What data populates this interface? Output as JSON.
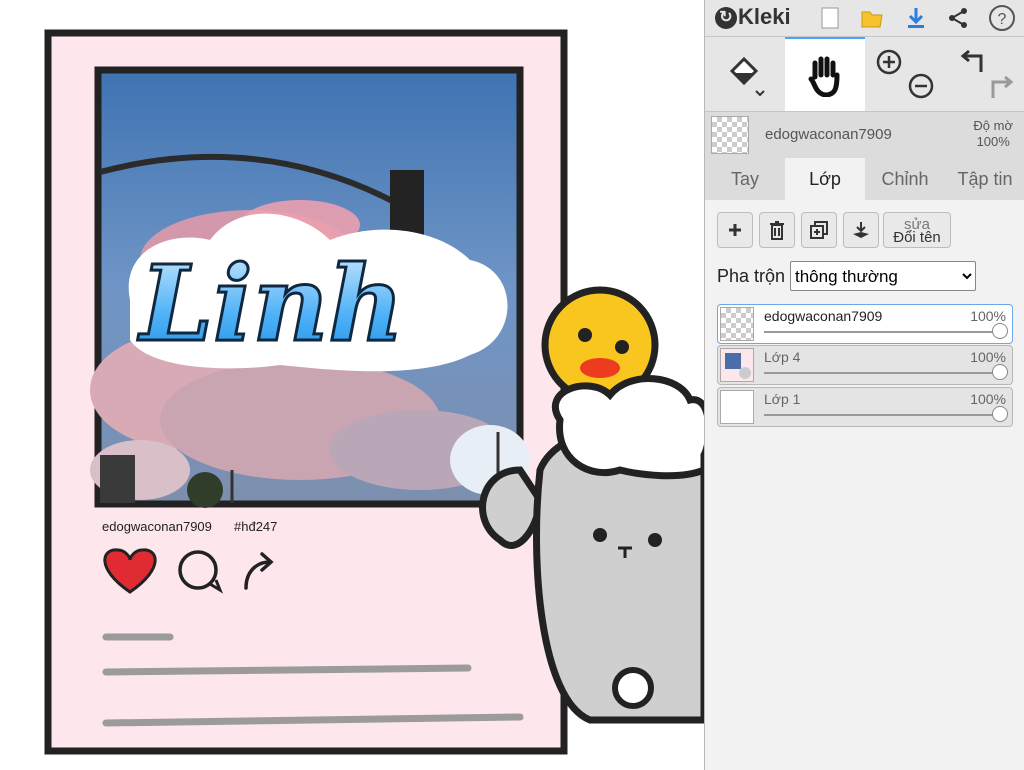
{
  "app": {
    "name": "Kleki"
  },
  "canvas": {
    "artwork_title": "Linh",
    "caption_user": "edogwaconan7909",
    "caption_tag": "#hđ247"
  },
  "toolbar": {
    "icons": [
      "new-file-icon",
      "open-folder-icon",
      "download-icon",
      "share-icon",
      "help-icon"
    ]
  },
  "tools": {
    "icons": [
      "paint-bucket-icon",
      "hand-icon",
      "zoom-in-icon",
      "zoom-out-icon",
      "undo-icon",
      "redo-icon"
    ]
  },
  "layer_info": {
    "name": "edogwaconan7909",
    "opacity_label": "Độ mờ",
    "opacity_value": "100%"
  },
  "tabs": [
    "Tay",
    "Lớp",
    "Chỉnh",
    "Tập tin"
  ],
  "layer_actions": {
    "rename_label_line1": "sửa",
    "rename_label_line2": "Đổi tên"
  },
  "blend": {
    "label": "Pha trộn",
    "selected": "thông thường"
  },
  "layers": [
    {
      "name": "edogwaconan7909",
      "opacity": "100%",
      "selected": true
    },
    {
      "name": "Lớp 4",
      "opacity": "100%",
      "selected": false
    },
    {
      "name": "Lớp 1",
      "opacity": "100%",
      "selected": false
    }
  ],
  "colors": {
    "accent": "#4aa3ff",
    "card_bg": "#fde6ec",
    "heart": "#e02b33"
  }
}
